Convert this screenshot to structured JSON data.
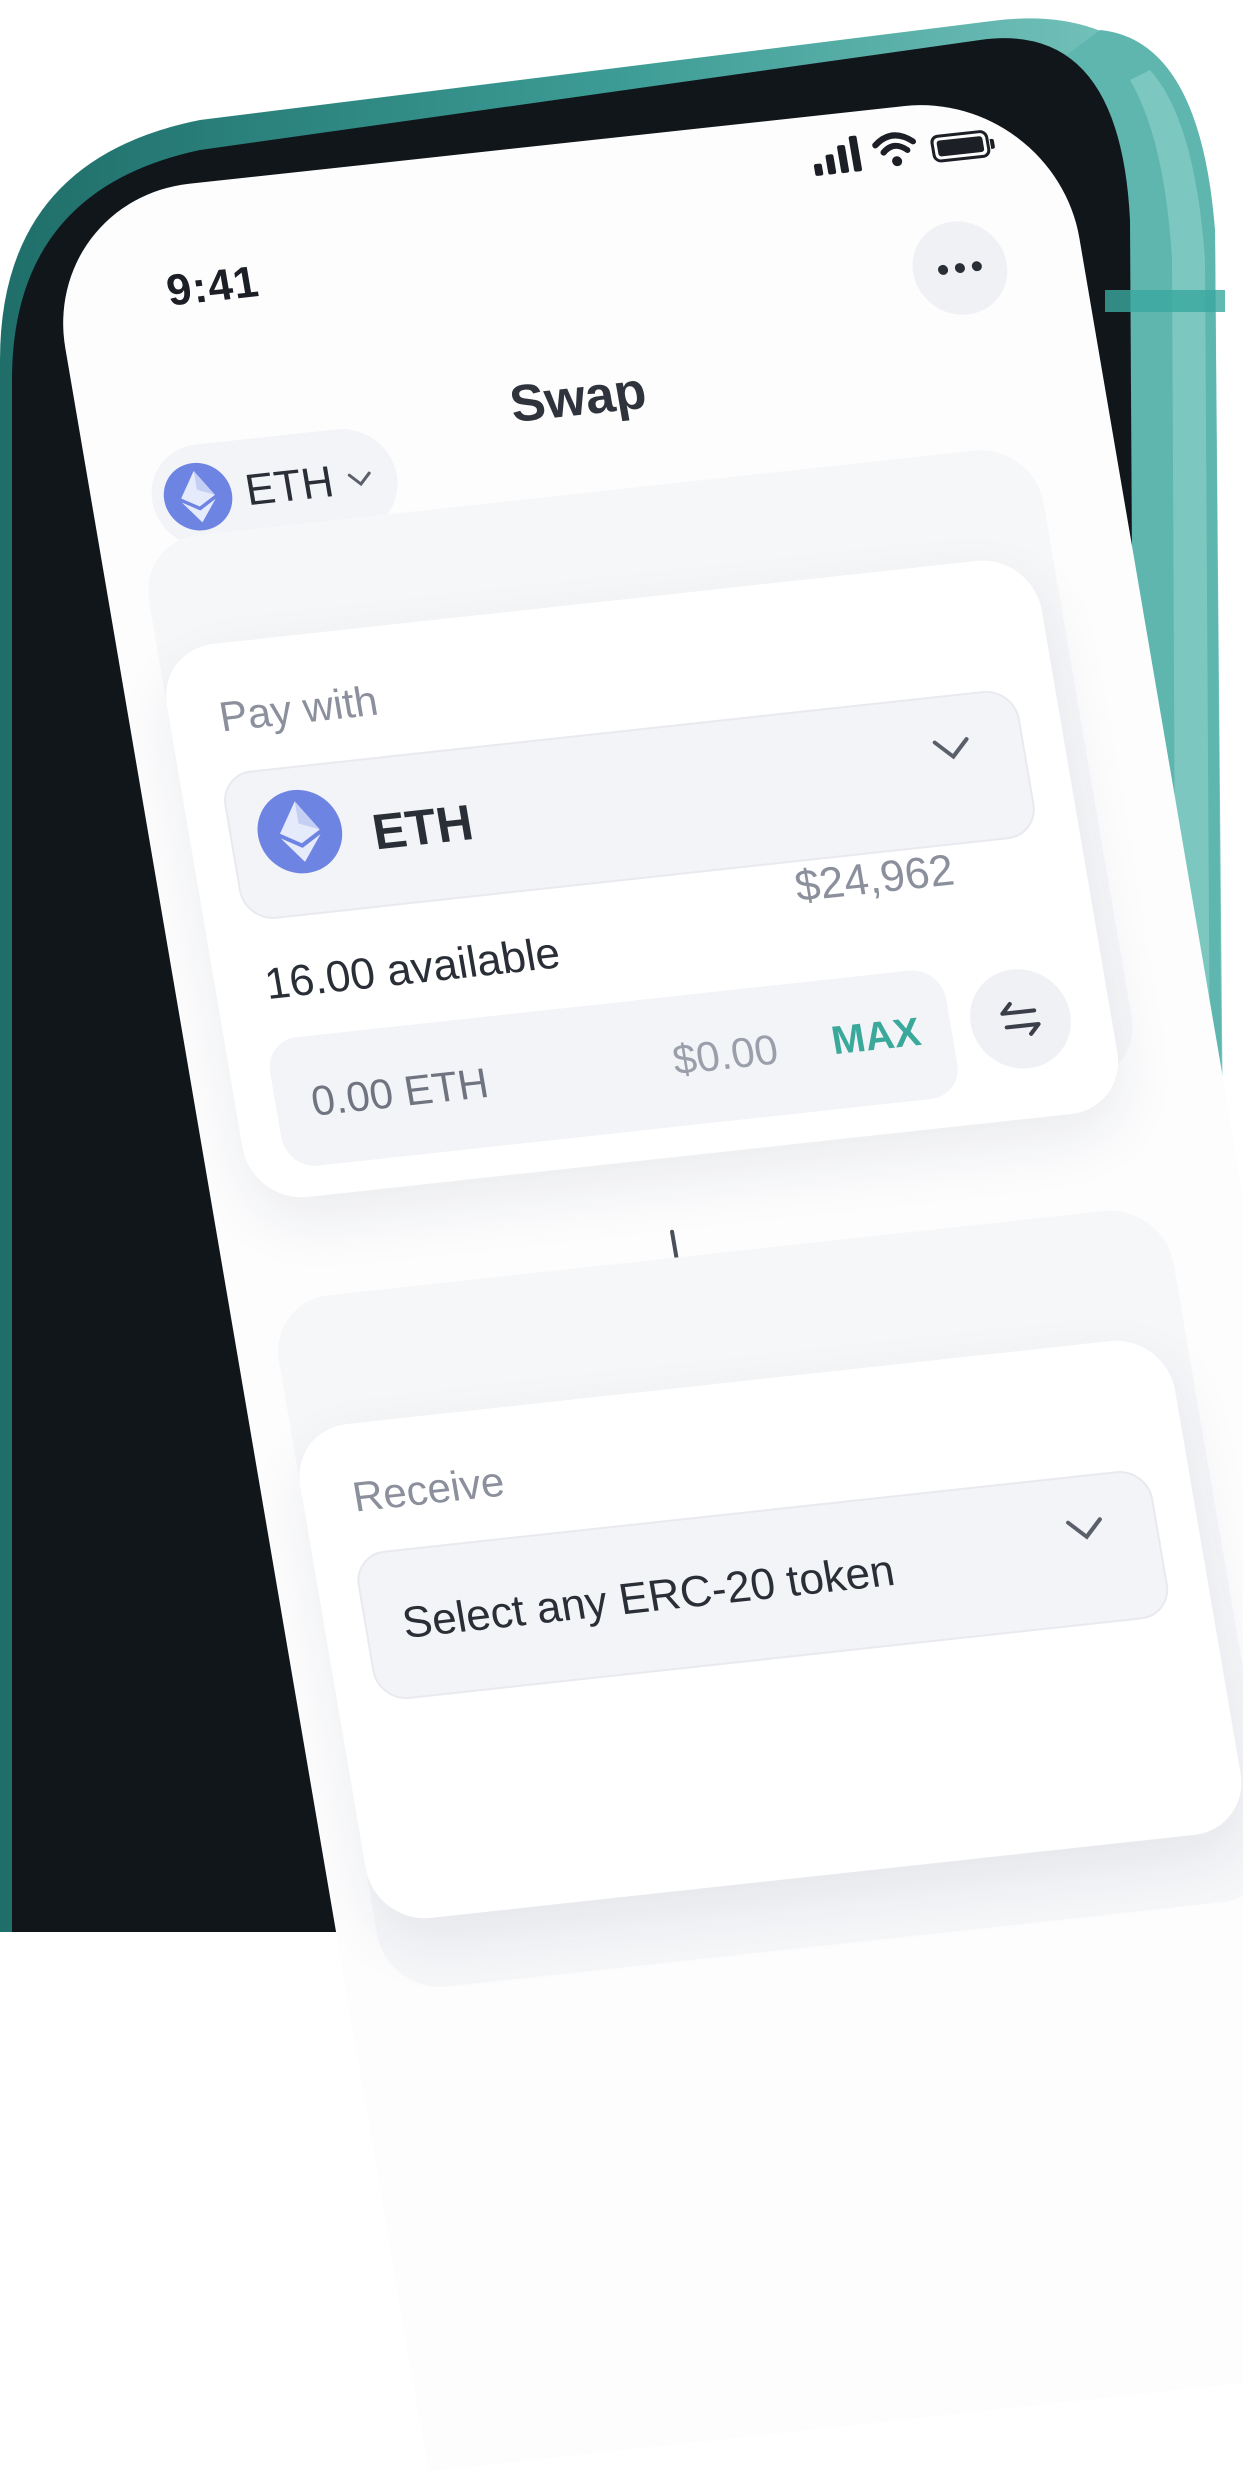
{
  "status_bar": {
    "time": "9:41",
    "icons": [
      "cellular-signal-icon",
      "wifi-icon",
      "battery-icon"
    ]
  },
  "header": {
    "title": "Swap",
    "network": {
      "label": "ETH",
      "icon": "ethereum-icon"
    },
    "more_icon": "more-horizontal-icon"
  },
  "pay": {
    "label": "Pay with",
    "token": "ETH",
    "available": "16.00 available",
    "balance_usd": "$24,962",
    "amount_placeholder": "0.00 ETH",
    "amount_usd": "$0.00",
    "max_label": "MAX"
  },
  "receive": {
    "label": "Receive",
    "placeholder": "Select any ERC-20 token"
  },
  "colors": {
    "phone_frame": "#2f8f88",
    "accent": "#3aa89b",
    "ethereum": "#6e84e3"
  }
}
